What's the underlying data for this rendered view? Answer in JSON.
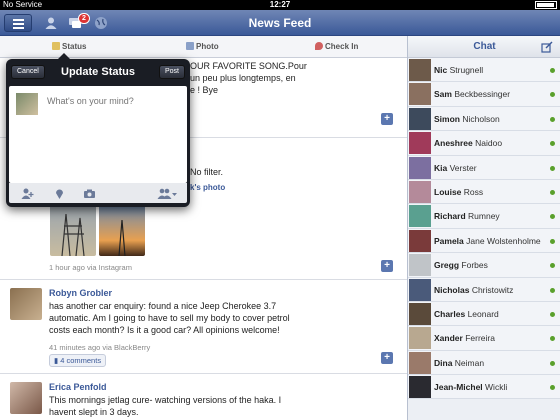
{
  "status_bar": {
    "carrier": "No Service",
    "time": "12:27"
  },
  "navbar": {
    "title": "News Feed",
    "notification_count": "2"
  },
  "tabs": [
    {
      "label": "Status"
    },
    {
      "label": "Photo"
    },
    {
      "label": "Check In"
    }
  ],
  "popover": {
    "title": "Update Status",
    "cancel_label": "Cancel",
    "post_label": "Post",
    "placeholder": "What's on your mind?"
  },
  "feed": {
    "post1": {
      "text_line1": "OUR FAVORITE SONG.Pour",
      "text_line2": "un peu plus longtemps, en",
      "text_line3": "e ! Bye"
    },
    "post2": {
      "text": "No filter.",
      "link": "k's photo",
      "meta": "1 hour ago via Instagram"
    },
    "post3": {
      "name": "Robyn Grobler",
      "text": "has another car enquiry: found a nice Jeep Cherokee 3.7 automatic. Am I going to have to sell my body to cover petrol costs each month? Is it a good car? All opinions welcome!",
      "meta": "41 minutes ago via BlackBerry",
      "comments": "4 comments"
    },
    "post4": {
      "name": "Erica Penfold",
      "text": "This mornings jetlag cure- watching versions of the haka. I havent slept in 3 days."
    }
  },
  "chat": {
    "title": "Chat",
    "contacts": [
      {
        "first": "Nic",
        "last": "Strugnell",
        "color": "#6d5a4a"
      },
      {
        "first": "Sam",
        "last": "Beckbessinger",
        "color": "#8a7060"
      },
      {
        "first": "Simon",
        "last": "Nicholson",
        "color": "#3d4a5c"
      },
      {
        "first": "Aneshree",
        "last": "Naidoo",
        "color": "#a03a5a"
      },
      {
        "first": "Kia",
        "last": "Verster",
        "color": "#7c6fa0"
      },
      {
        "first": "Louise",
        "last": "Ross",
        "color": "#b48a9a"
      },
      {
        "first": "Richard",
        "last": "Rumney",
        "color": "#5aa090"
      },
      {
        "first": "Pamela",
        "last": "Jane Wolstenholme",
        "color": "#7a3a3a"
      },
      {
        "first": "Gregg",
        "last": "Forbes",
        "color": "#c0c4c8"
      },
      {
        "first": "Nicholas",
        "last": "Christowitz",
        "color": "#4a5a7a"
      },
      {
        "first": "Charles",
        "last": "Leonard",
        "color": "#5a4a3a"
      },
      {
        "first": "Xander",
        "last": "Ferreira",
        "color": "#b8a890"
      },
      {
        "first": "Dina",
        "last": "Neiman",
        "color": "#9a7a6a"
      },
      {
        "first": "Jean-Michel",
        "last": "Wickli",
        "color": "#2a2a30"
      }
    ],
    "online_color": "#5aa02c"
  }
}
